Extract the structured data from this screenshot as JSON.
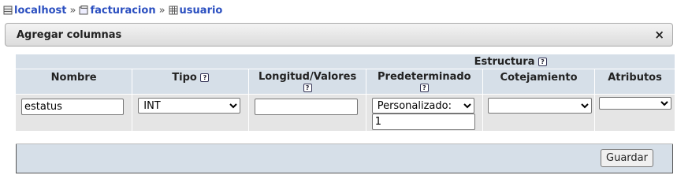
{
  "breadcrumb": {
    "items": [
      {
        "label": "localhost",
        "icon": "server-icon"
      },
      {
        "label": "facturacion",
        "icon": "database-icon"
      },
      {
        "label": "usuario",
        "icon": "table-icon"
      }
    ],
    "separator": "»"
  },
  "dialog": {
    "title": "Agregar columnas",
    "close_label": "×"
  },
  "table": {
    "group_header": "Estructura",
    "headers": {
      "nombre": "Nombre",
      "tipo": "Tipo",
      "longitud": "Longitud/Valores",
      "predeterminado": "Predeterminado",
      "cotejamiento": "Cotejamiento",
      "atributos": "Atributos"
    },
    "row": {
      "nombre_value": "estatus",
      "tipo_value": "INT",
      "longitud_value": "",
      "predeterminado_value": "Personalizado:",
      "predeterminado_custom": "1",
      "cotejamiento_value": "",
      "atributos_value": ""
    }
  },
  "footer": {
    "save_label": "Guardar"
  },
  "colors": {
    "header_bg": "#d6dfe8",
    "link": "#2b4fc0"
  }
}
